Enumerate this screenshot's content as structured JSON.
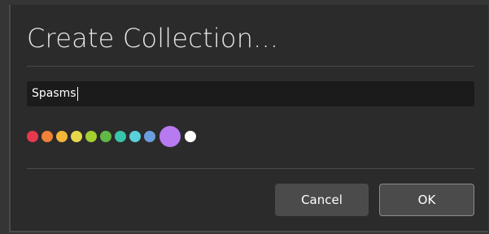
{
  "dialog": {
    "title": "Create Collection...",
    "name_input": {
      "value": "Spasms"
    },
    "colors": [
      {
        "name": "red",
        "hex": "#e8384f",
        "selected": false
      },
      {
        "name": "orange",
        "hex": "#f0803a",
        "selected": false
      },
      {
        "name": "yellow-orange",
        "hex": "#f4b63a",
        "selected": false
      },
      {
        "name": "yellow",
        "hex": "#e6d84a",
        "selected": false
      },
      {
        "name": "yellow-green",
        "hex": "#a4cf30",
        "selected": false
      },
      {
        "name": "green",
        "hex": "#62b847",
        "selected": false
      },
      {
        "name": "teal",
        "hex": "#37c5ab",
        "selected": false
      },
      {
        "name": "aqua",
        "hex": "#5ad0da",
        "selected": false
      },
      {
        "name": "blue",
        "hex": "#6a9ede",
        "selected": false
      },
      {
        "name": "purple",
        "hex": "#b87af0",
        "selected": true
      },
      {
        "name": "white",
        "hex": "#ffffff",
        "selected": false
      }
    ],
    "buttons": {
      "cancel_label": "Cancel",
      "ok_label": "OK"
    }
  }
}
